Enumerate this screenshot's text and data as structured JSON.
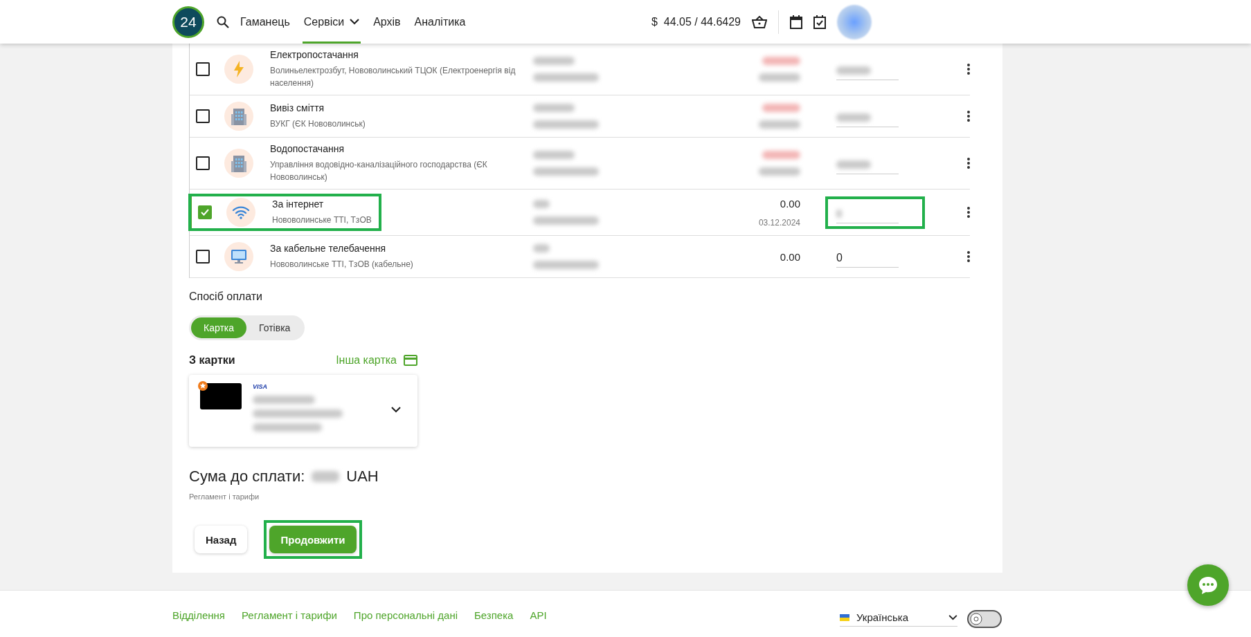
{
  "header": {
    "logo": "24",
    "nav": [
      {
        "label": "Гаманець",
        "selected": false,
        "dropdown": false
      },
      {
        "label": "Сервіси",
        "selected": true,
        "dropdown": true
      },
      {
        "label": "Архів",
        "selected": false,
        "dropdown": false
      },
      {
        "label": "Аналітика",
        "selected": false,
        "dropdown": false
      }
    ],
    "rate_symbol": "$",
    "rate": "44.05 / 44.6429"
  },
  "services": [
    {
      "kind": "electricity",
      "name": "Електропостачання",
      "provider": "Волиньелектрозбут, Нововолинський ТЦОК (Електроенергія від населення)",
      "checked": false,
      "highlighted": false,
      "amount_highlighted": false
    },
    {
      "kind": "building",
      "name": "Вивіз сміття",
      "provider": "ВУКГ (ЄК Нововолинськ)",
      "checked": false,
      "highlighted": false,
      "amount_highlighted": false
    },
    {
      "kind": "building",
      "name": "Водопостачання",
      "provider": "Управління водовідно-каналізаційного господарства (ЄК Нововолинськ)",
      "checked": false,
      "highlighted": false,
      "amount_highlighted": false
    },
    {
      "kind": "internet",
      "name": "За інтернет",
      "provider": "Нововолинське ТТІ, ТзОВ",
      "checked": true,
      "highlighted": true,
      "balance": "0.00",
      "date": "03.12.2024",
      "amount_highlighted": true
    },
    {
      "kind": "tv",
      "name": "За кабельне телебачення",
      "provider": "Нововолинське ТТІ, ТзОВ (кабельне)",
      "checked": false,
      "highlighted": false,
      "balance": "0.00",
      "amount": "0",
      "amount_highlighted": false
    }
  ],
  "payment": {
    "label": "Спосіб оплати",
    "methods": [
      {
        "label": "Картка",
        "selected": true
      },
      {
        "label": "Готівка",
        "selected": false
      }
    ],
    "from_card": "З картки",
    "other_card": "Інша картка",
    "card_brand": "VISA",
    "total_label": "Сума до сплати:",
    "currency": "UAH",
    "tariffs": "Регламент і тарифи",
    "buttons": [
      {
        "label": "Назад",
        "kind": "secondary",
        "highlighted": false
      },
      {
        "label": "Продовжити",
        "kind": "primary",
        "highlighted": true
      }
    ]
  },
  "footer": {
    "links": [
      "Відділення",
      "Регламент і тарифи",
      "Про персональні дані",
      "Безпека",
      "API"
    ],
    "language": "Українська",
    "dark_mode": false
  }
}
